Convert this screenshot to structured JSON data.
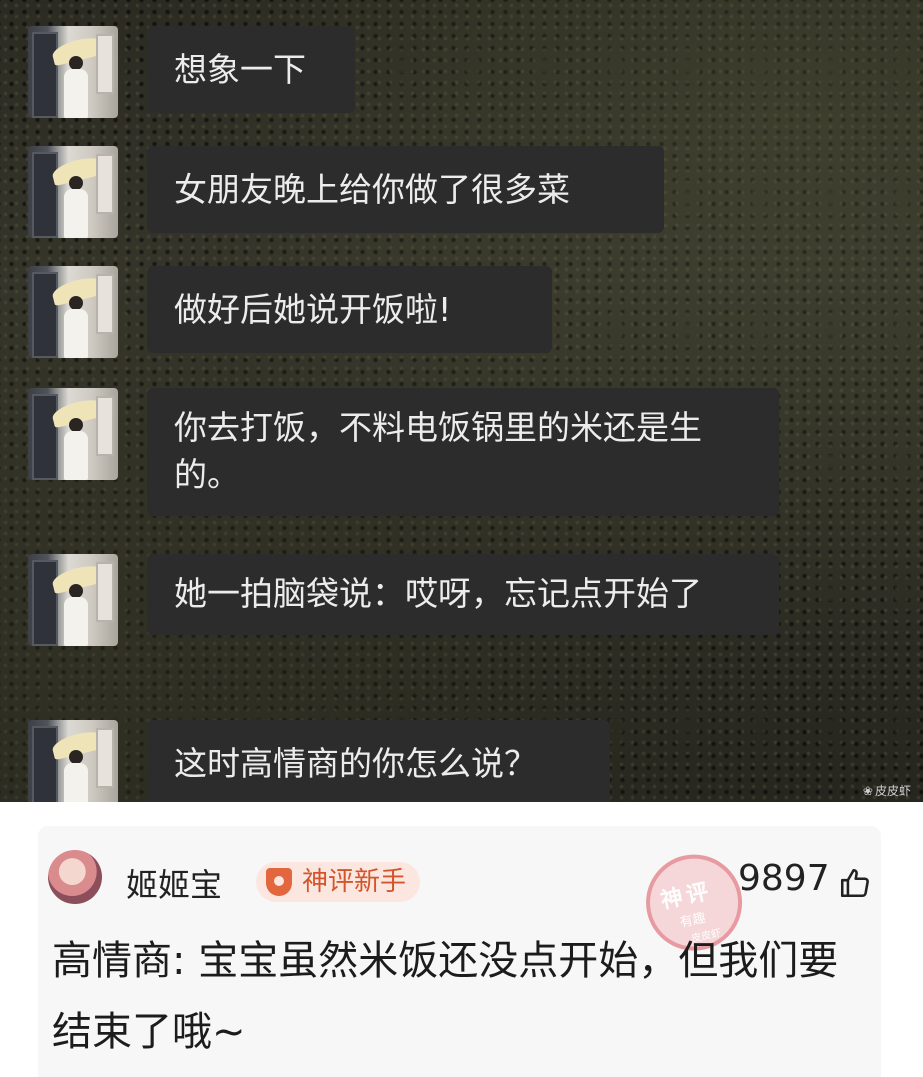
{
  "chat": {
    "messages": [
      {
        "text": "想象一下"
      },
      {
        "text": "女朋友晚上给你做了很多菜"
      },
      {
        "text": "做好后她说开饭啦!"
      },
      {
        "text": "你去打饭，不料电饭锅里的米还是生的。"
      },
      {
        "text": "她一拍脑袋说：哎呀，忘记点开始了"
      },
      {
        "text": "这时高情商的你怎么说？"
      }
    ],
    "watermark": "皮皮虾",
    "watermark_icon": "paw-icon"
  },
  "comment": {
    "username": "姬姬宝",
    "badge": "神评新手",
    "stamp": {
      "title": "神评",
      "subtitle": "有趣",
      "footer": "皮皮虾"
    },
    "likes": "9897",
    "text": "高情商: 宝宝虽然米饭还没点开始，但我们要结束了哦~"
  },
  "colors": {
    "bubble_bg": "#2c2c2c",
    "bubble_text": "#ececec",
    "badge_text": "#d3552b",
    "badge_bg": "#fbe7df",
    "stamp": "#e58c93"
  }
}
